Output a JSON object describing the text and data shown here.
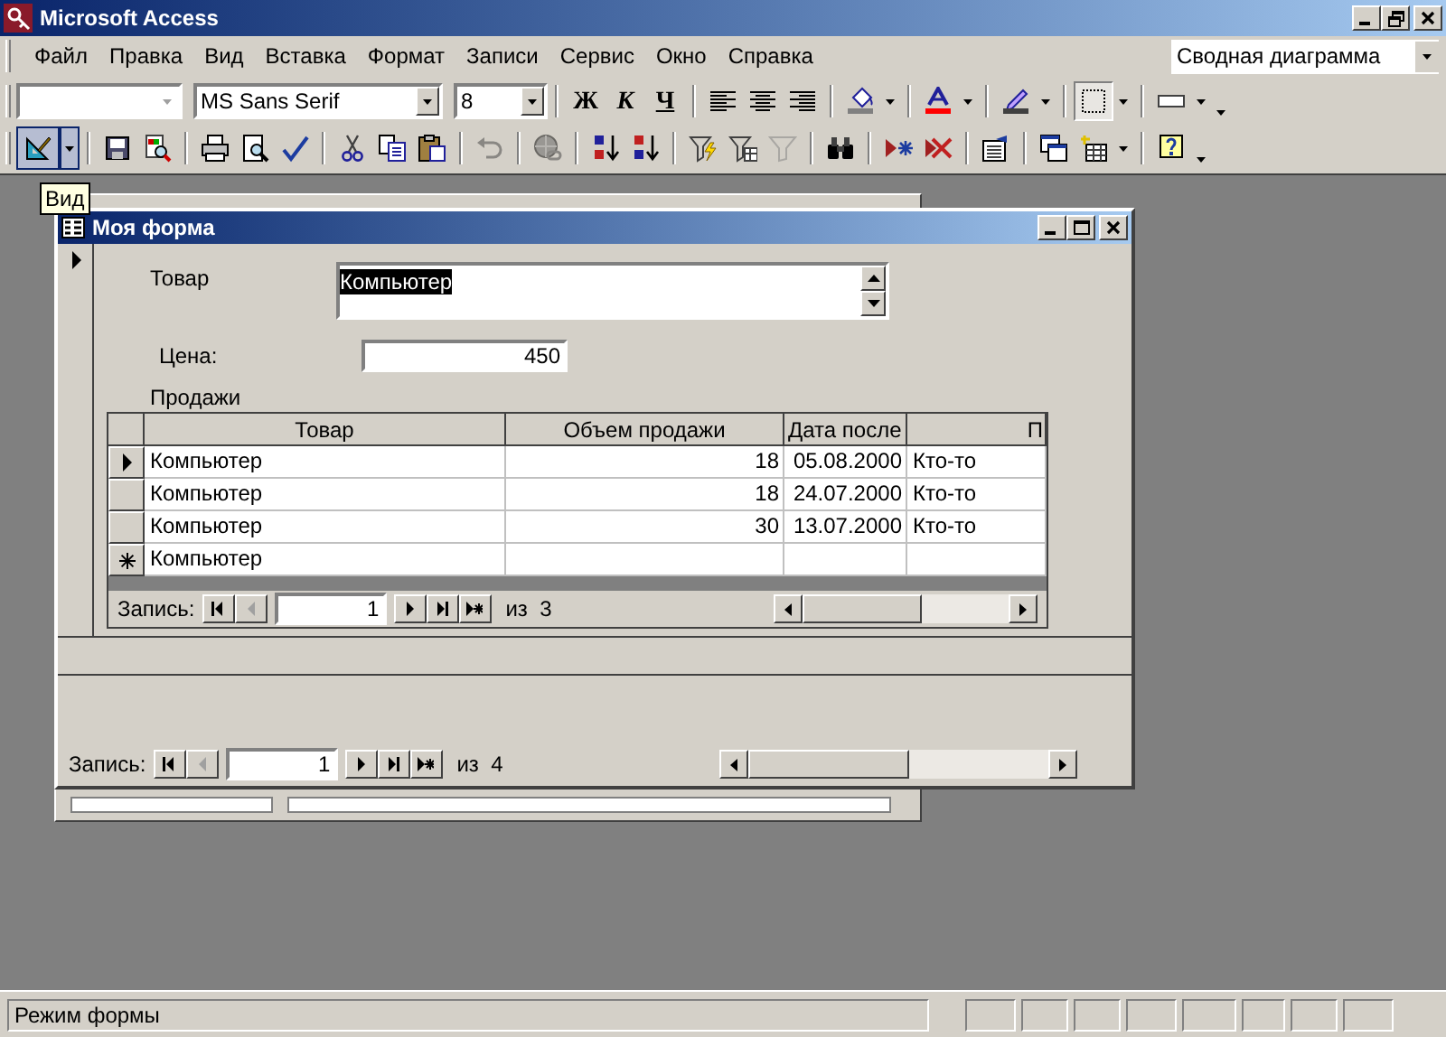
{
  "app": {
    "title": "Microsoft Access"
  },
  "menu": [
    "Файл",
    "Правка",
    "Вид",
    "Вставка",
    "Формат",
    "Записи",
    "Сервис",
    "Окно",
    "Справка"
  ],
  "pivot_combo": {
    "value": "Сводная диаграмма"
  },
  "format_toolbar": [
    {
      "kind": "object_combo",
      "disabled": true
    },
    {
      "kind": "font_combo",
      "value": "MS Sans Serif"
    },
    {
      "kind": "size_combo",
      "value": "8"
    },
    {
      "kind": "separator"
    },
    {
      "kind": "bold",
      "label": "Ж"
    },
    {
      "kind": "italic",
      "label": "К"
    },
    {
      "kind": "underline",
      "label": "Ч"
    },
    {
      "kind": "separator"
    },
    {
      "kind": "align_left"
    },
    {
      "kind": "align_center"
    },
    {
      "kind": "align_right"
    },
    {
      "kind": "separator"
    },
    {
      "kind": "fill_color"
    },
    {
      "kind": "dropdown"
    },
    {
      "kind": "separator"
    },
    {
      "kind": "font_color"
    },
    {
      "kind": "dropdown"
    },
    {
      "kind": "separator"
    },
    {
      "kind": "line_color"
    },
    {
      "kind": "dropdown"
    },
    {
      "kind": "separator"
    },
    {
      "kind": "border",
      "pressed": true
    },
    {
      "kind": "dropdown"
    },
    {
      "kind": "separator"
    },
    {
      "kind": "line_style"
    },
    {
      "kind": "dropdown"
    },
    {
      "kind": "overflow"
    }
  ],
  "form_toolbar": [
    {
      "kind": "view",
      "pressed": true,
      "tooltip": "Вид"
    },
    {
      "kind": "view_dropdown"
    },
    {
      "kind": "separator"
    },
    {
      "kind": "save"
    },
    {
      "kind": "page_search"
    },
    {
      "kind": "separator"
    },
    {
      "kind": "print"
    },
    {
      "kind": "print_preview"
    },
    {
      "kind": "spelling"
    },
    {
      "kind": "separator"
    },
    {
      "kind": "cut"
    },
    {
      "kind": "copy"
    },
    {
      "kind": "paste"
    },
    {
      "kind": "separator"
    },
    {
      "kind": "undo",
      "disabled": true
    },
    {
      "kind": "separator"
    },
    {
      "kind": "hyperlink",
      "disabled": true
    },
    {
      "kind": "separator"
    },
    {
      "kind": "sort_asc"
    },
    {
      "kind": "sort_desc"
    },
    {
      "kind": "separator"
    },
    {
      "kind": "filter_selection"
    },
    {
      "kind": "filter_form"
    },
    {
      "kind": "apply_filter",
      "disabled": true
    },
    {
      "kind": "separator"
    },
    {
      "kind": "find"
    },
    {
      "kind": "separator"
    },
    {
      "kind": "new_record"
    },
    {
      "kind": "delete_record"
    },
    {
      "kind": "separator"
    },
    {
      "kind": "properties"
    },
    {
      "kind": "separator"
    },
    {
      "kind": "database_window"
    },
    {
      "kind": "new_object"
    },
    {
      "kind": "dropdown"
    },
    {
      "kind": "separator"
    },
    {
      "kind": "help"
    },
    {
      "kind": "overflow"
    }
  ],
  "form": {
    "title": "Моя форма",
    "fields": [
      {
        "kind": "listbox",
        "label": "Товар",
        "value": "Компьютер",
        "selected": true
      },
      {
        "kind": "textbox",
        "label": "Цена:",
        "value": "450"
      }
    ],
    "subform": {
      "label": "Продажи",
      "columns": [
        "Товар",
        "Объем продажи",
        "Дата после",
        "П"
      ],
      "rows": [
        {
          "kind": "record",
          "selected": true,
          "cells": [
            "Компьютер",
            "18",
            "05.08.2000",
            "Кто-то"
          ]
        },
        {
          "kind": "record",
          "selected": false,
          "cells": [
            "Компьютер",
            "18",
            "24.07.2000",
            "Кто-то"
          ]
        },
        {
          "kind": "record",
          "selected": false,
          "cells": [
            "Компьютер",
            "30",
            "13.07.2000",
            "Кто-то"
          ]
        },
        {
          "kind": "new",
          "selected": false,
          "cells": [
            "Компьютер"
          ]
        }
      ],
      "navigation": {
        "label": "Запись:",
        "current": "1",
        "total": "из  3",
        "prev_disabled": true
      }
    },
    "navigation": {
      "label": "Запись:",
      "current": "1",
      "total": "из  4",
      "prev_disabled": true
    }
  },
  "status_bar": {
    "text": "Режим формы"
  }
}
